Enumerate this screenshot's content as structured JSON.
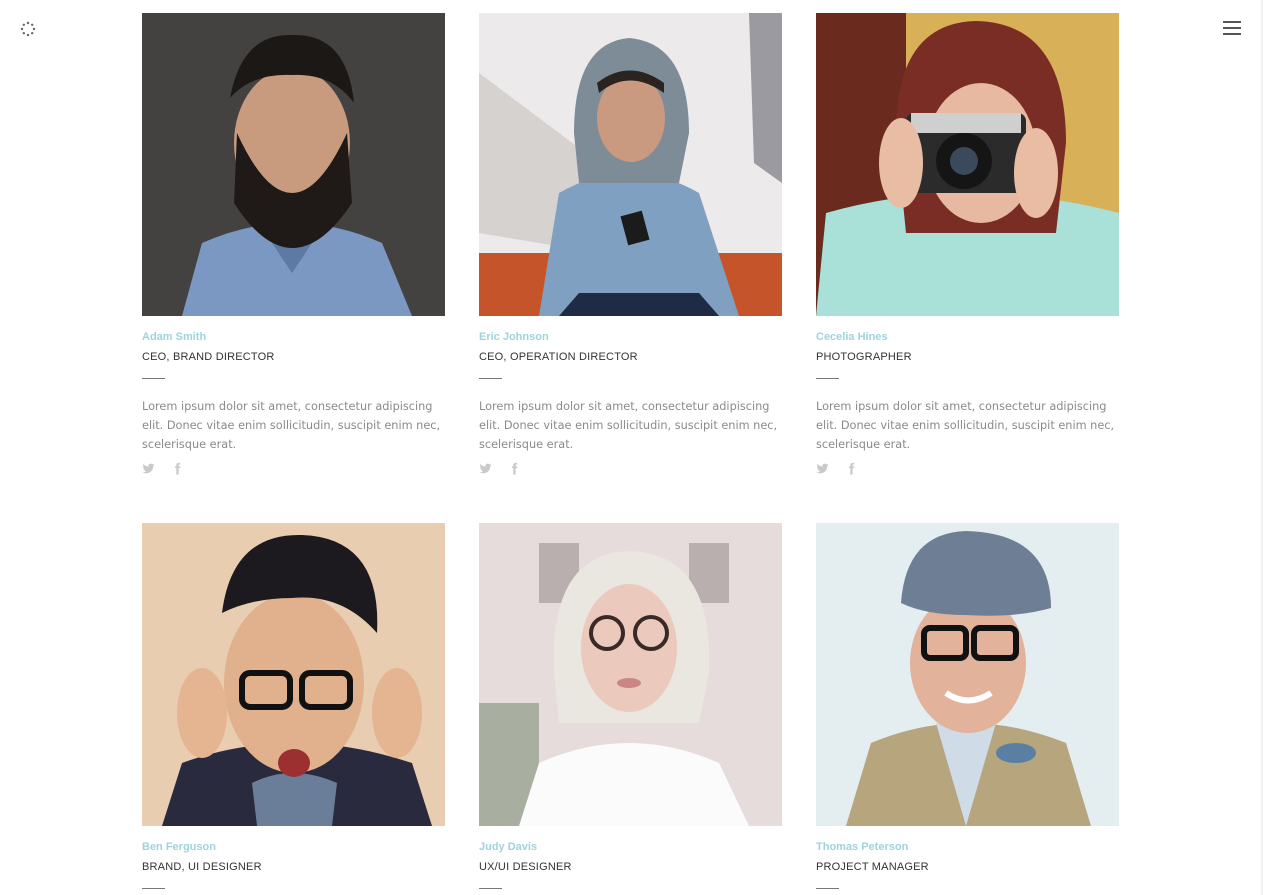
{
  "header": {
    "logo_icon": "loader-dots-icon",
    "menu_icon": "hamburger-menu-icon"
  },
  "team": [
    {
      "name": "Adam Smith",
      "role": "CEO, BRAND DIRECTOR",
      "bio": "Lorem ipsum dolor sit amet, consectetur adipiscing elit. Donec vitae enim sollicitudin, suscipit enim nec, scelerisque erat.",
      "photo": "portrait-bearded-man"
    },
    {
      "name": "Eric Johnson",
      "role": "CEO, OPERATION DIRECTOR",
      "bio": "Lorem ipsum dolor sit amet, consectetur adipiscing elit. Donec vitae enim sollicitudin, suscipit enim nec, scelerisque erat.",
      "photo": "portrait-hooded-man-phone"
    },
    {
      "name": "Cecelia Hines",
      "role": "PHOTOGRAPHER",
      "bio": "Lorem ipsum dolor sit amet, consectetur adipiscing elit. Donec vitae enim sollicitudin, suscipit enim nec, scelerisque erat.",
      "photo": "portrait-woman-camera"
    },
    {
      "name": "Ben Ferguson",
      "role": "BRAND, UI DESIGNER",
      "photo": "portrait-surprised-man-glasses"
    },
    {
      "name": "Judy Davis",
      "role": "UX/UI DESIGNER",
      "photo": "portrait-blonde-woman-glasses"
    },
    {
      "name": "Thomas Peterson",
      "role": "PROJECT MANAGER",
      "photo": "portrait-man-cap-bowtie"
    }
  ],
  "colors": {
    "accent": "#9fd3dc",
    "text": "#333333",
    "muted": "#8a8a8a"
  }
}
